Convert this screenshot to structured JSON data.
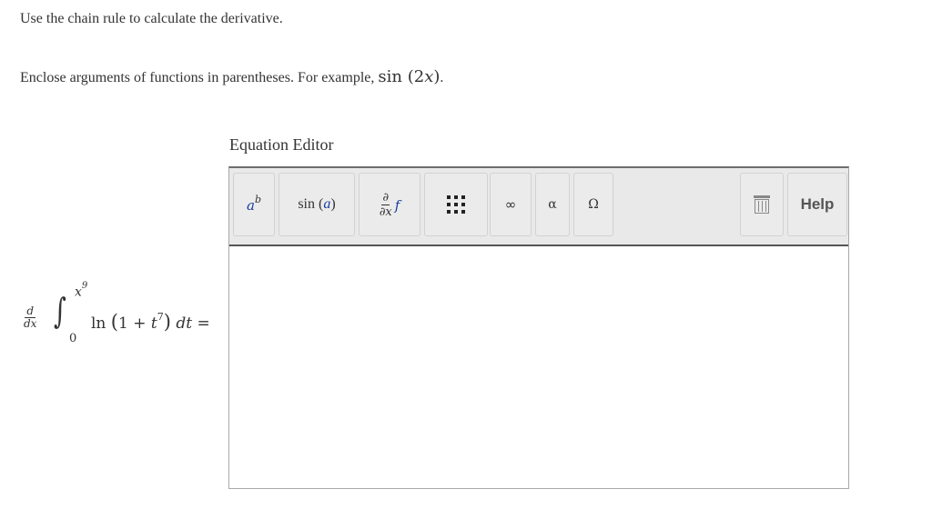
{
  "instructions": {
    "line1": "Use the chain rule to calculate the derivative.",
    "line2_prefix": "Enclose arguments of functions in parentheses. For example, ",
    "example_fn": "sin",
    "example_open": " (2",
    "example_var": "x",
    "example_close": ")",
    "line2_suffix": "."
  },
  "problem": {
    "d_num": "d",
    "d_den": "dx",
    "integral_sign": "∫",
    "upper_base": "x",
    "upper_exp": "9",
    "lower": "0",
    "fn": "ln",
    "arg_open": "(",
    "arg_inner": "1 + ",
    "arg_var": "t",
    "arg_exp": "7",
    "arg_close": ")",
    "differential": "dt",
    "equals": "="
  },
  "editor": {
    "title": "Equation Editor",
    "toolbar": {
      "power_base": "a",
      "power_exp": "b",
      "sin_fn": "sin",
      "sin_open": " (",
      "sin_var": "a",
      "sin_close": ")",
      "deriv_num": "∂",
      "deriv_den": "∂x",
      "deriv_f": "f",
      "infinity": "∞",
      "alpha": "α",
      "omega": "Ω",
      "help": "Help"
    }
  }
}
